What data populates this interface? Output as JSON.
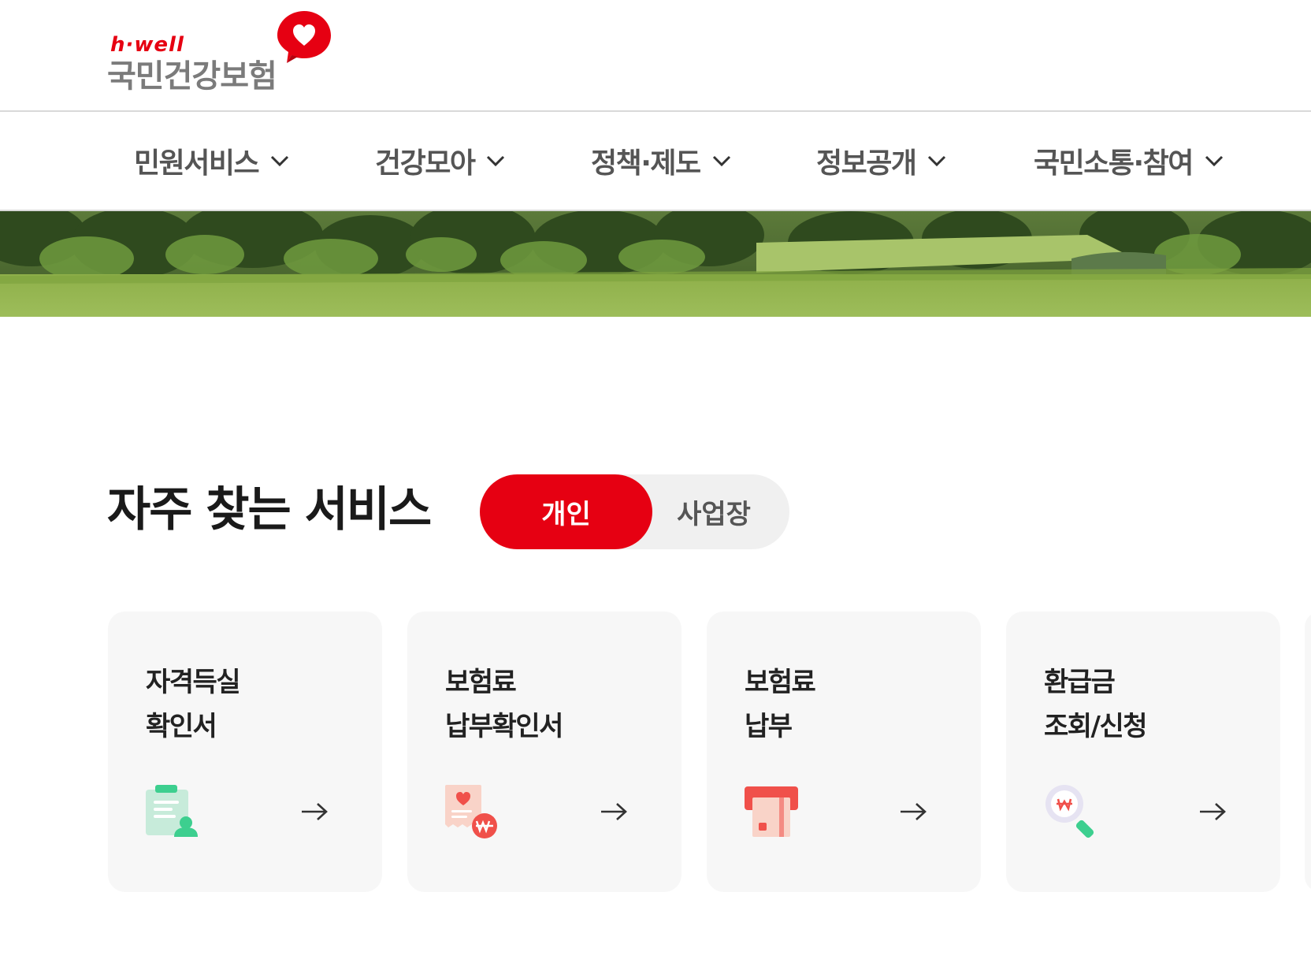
{
  "header": {
    "logo_small": "h·well",
    "logo_main": "국민건강보험"
  },
  "nav": {
    "items": [
      {
        "label": "민원서비스"
      },
      {
        "label": "건강모아"
      },
      {
        "label": "정책·제도"
      },
      {
        "label": "정보공개"
      },
      {
        "label": "국민소통·참여"
      }
    ],
    "chevron_icon": "chevron-down-icon"
  },
  "banner": {
    "image": "park-landscape"
  },
  "services": {
    "title": "자주 찾는 서비스",
    "toggle": {
      "selected": "개인",
      "options": [
        "개인",
        "사업장"
      ]
    },
    "cards": [
      {
        "line1": "자격득실",
        "line2": "확인서",
        "icon": "certificate-user-icon"
      },
      {
        "line1": "보험료",
        "line2": "납부확인서",
        "icon": "receipt-won-icon"
      },
      {
        "line1": "보험료",
        "line2": "납부",
        "icon": "card-payment-icon"
      },
      {
        "line1": "환급금",
        "line2": "조회/신청",
        "icon": "search-won-icon"
      }
    ],
    "arrow_icon": "arrow-right-icon"
  },
  "colors": {
    "brand_red": "#e60012",
    "card_bg": "#f7f7f7",
    "toggle_bg": "#f0f0f0",
    "mint": "#3dcf8f"
  }
}
